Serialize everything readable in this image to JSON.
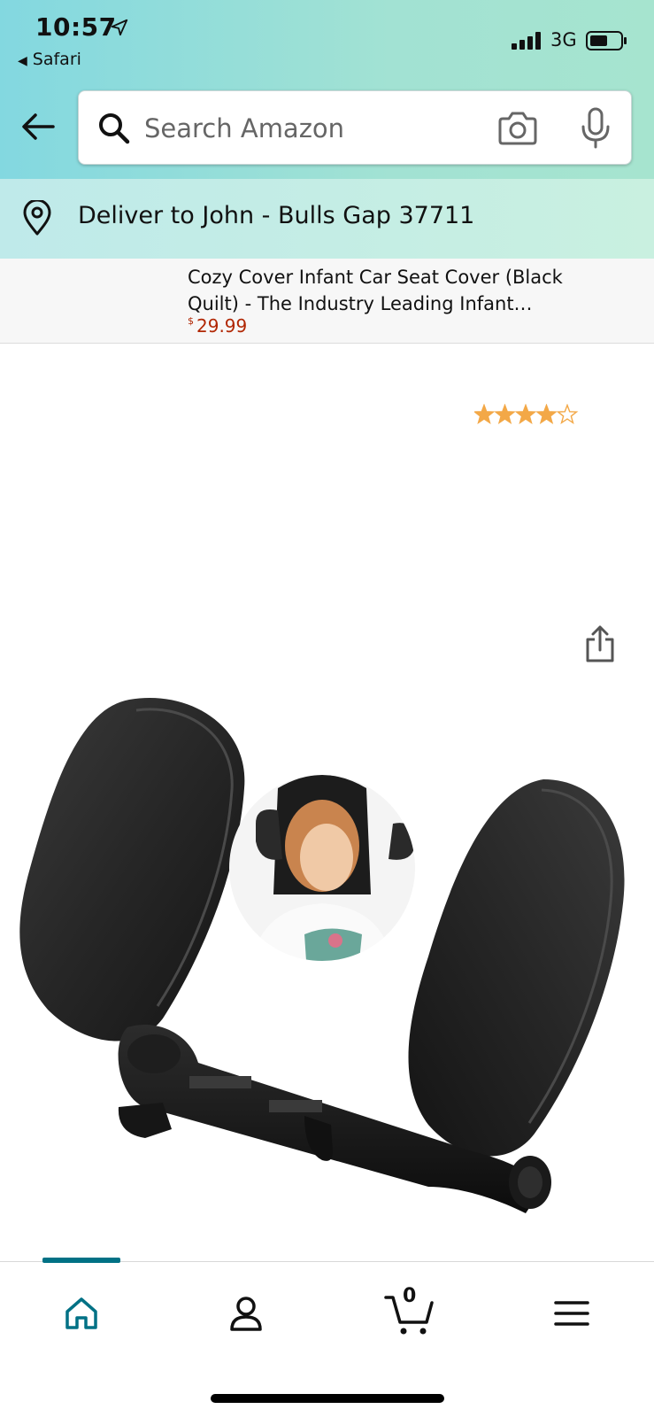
{
  "status_bar": {
    "time": "10:57",
    "back_app": "Safari",
    "network": "3G"
  },
  "search": {
    "placeholder": "Search Amazon"
  },
  "delivery": {
    "text": "Deliver to John - Bulls Gap 37711"
  },
  "sticky_product": {
    "title": "Cozy Cover Infant Car Seat Cover (Black Quilt) - The Industry Leading Infant…",
    "currency_symbol": "$",
    "price": "29.99"
  },
  "product": {
    "rating_stars": 4,
    "rating_max": 5,
    "star_color": "#f3a847"
  },
  "bottom_nav": {
    "cart_count": "0",
    "active_tab": "home",
    "accent_color": "#007185",
    "items": [
      {
        "name": "home",
        "icon": "home-icon"
      },
      {
        "name": "account",
        "icon": "account-icon"
      },
      {
        "name": "cart",
        "icon": "cart-icon"
      },
      {
        "name": "menu",
        "icon": "menu-icon"
      }
    ]
  }
}
